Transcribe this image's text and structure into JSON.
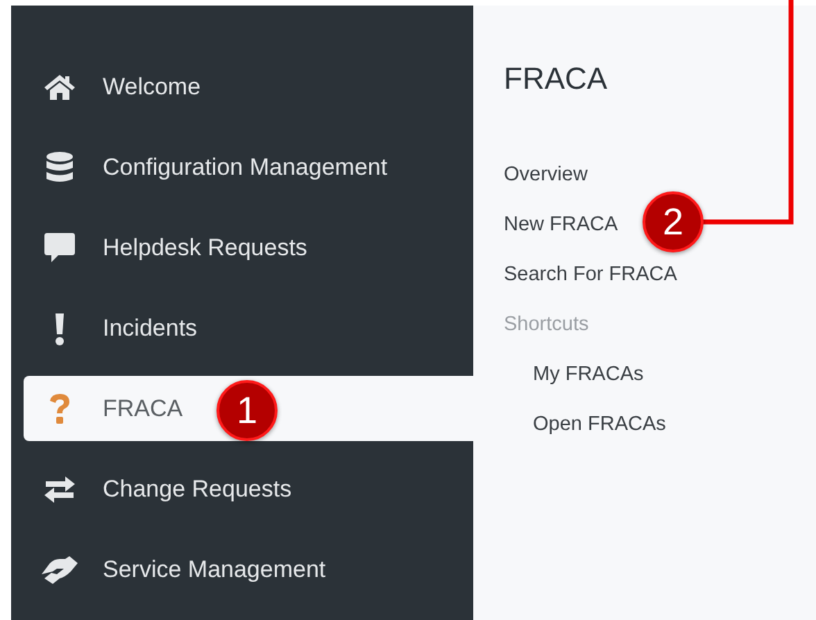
{
  "sidebar": {
    "items": [
      {
        "label": "Welcome",
        "selected": false
      },
      {
        "label": "Configuration Management",
        "selected": false
      },
      {
        "label": "Helpdesk Requests",
        "selected": false
      },
      {
        "label": "Incidents",
        "selected": false
      },
      {
        "label": "FRACA",
        "selected": true
      },
      {
        "label": "Change Requests",
        "selected": false
      },
      {
        "label": "Service Management",
        "selected": false
      }
    ]
  },
  "panel": {
    "title": "FRACA",
    "links": [
      {
        "label": "Overview",
        "kind": "link"
      },
      {
        "label": "New FRACA",
        "kind": "link"
      },
      {
        "label": "Search For FRACA",
        "kind": "link"
      },
      {
        "label": "Shortcuts",
        "kind": "heading"
      },
      {
        "label": "My FRACAs",
        "kind": "sublink"
      },
      {
        "label": "Open FRACAs",
        "kind": "sublink"
      }
    ]
  },
  "callouts": [
    {
      "number": "1"
    },
    {
      "number": "2"
    }
  ]
}
